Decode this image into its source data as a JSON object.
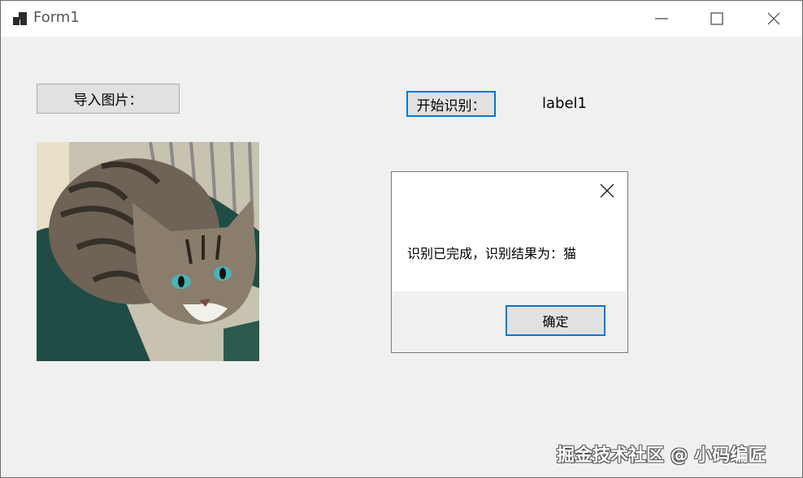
{
  "window": {
    "title": "Form1"
  },
  "toolbar": {
    "import_label": "导入图片：",
    "start_label": "开始识别：",
    "result_label": "label1"
  },
  "image": {
    "subject": "cat"
  },
  "dialog": {
    "message": "识别已完成，识别结果为：猫",
    "ok_label": "确定"
  },
  "watermark": {
    "text": "掘金技术社区 @ 小码编匠"
  },
  "colors": {
    "accent": "#0078d7",
    "background": "#f0f0f0",
    "button": "#e1e1e1"
  }
}
